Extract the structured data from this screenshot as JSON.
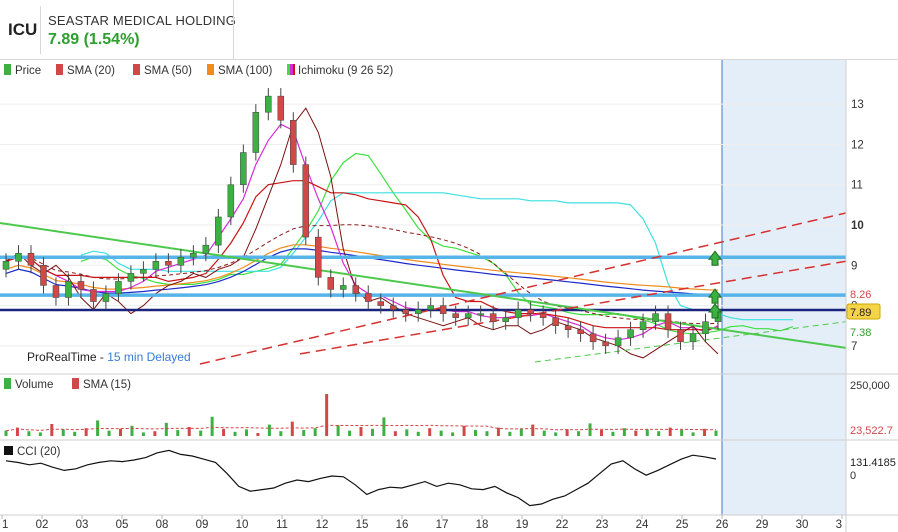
{
  "header": {
    "ticker": "ICU",
    "company": "SEASTAR MEDICAL HOLDING",
    "last": "7.89",
    "change": "(1.54%)"
  },
  "colors": {
    "up": "#3cb043",
    "down": "#d04848",
    "sma20": "#8b1a1a",
    "sma50": "#1c2bc8",
    "sma100": "#f08c1e",
    "tenkan": "#d62ad6",
    "kijun": "#c81414",
    "spanA": "#3ce03c",
    "spanB": "#3ce0e0",
    "future": "#e4eef8",
    "hline": "#56b4e9",
    "price_line": "#1a237e"
  },
  "legend": {
    "price": "Price",
    "sma20": "SMA (20)",
    "sma50": "SMA (50)",
    "sma100": "SMA (100)",
    "ichimoku": "Ichimoku (9 26 52)",
    "volume": "Volume",
    "vol_sma": "SMA (15)",
    "cci": "CCI (20)"
  },
  "watermark": {
    "brand": "ProRealTime",
    "dash": " - ",
    "delay": "15 min Delayed"
  },
  "chart_data": [
    {
      "type": "candlestick",
      "x_axis_labels": [
        "1",
        "02",
        "03",
        "05",
        "08",
        "09",
        "10",
        "11",
        "12",
        "15",
        "16",
        "17",
        "18",
        "19",
        "22",
        "23",
        "24",
        "25",
        "26",
        "29",
        "30",
        "3"
      ],
      "y_ticks": [
        "13",
        "12",
        "11",
        "10",
        "9",
        "8",
        "7"
      ],
      "ylim": [
        6.5,
        13.6
      ],
      "price_badge": "7.89",
      "labels": {
        "red": "8.26",
        "green": "7.38"
      },
      "horizontal_levels": [
        9.2,
        8.26,
        7.89
      ],
      "closes": [
        9.1,
        9.3,
        9.0,
        8.5,
        8.2,
        8.6,
        8.4,
        8.1,
        8.3,
        8.6,
        8.8,
        8.9,
        9.1,
        9.0,
        9.2,
        9.3,
        9.5,
        10.2,
        11.0,
        11.8,
        12.8,
        13.2,
        12.6,
        11.5,
        9.7,
        8.7,
        8.4,
        8.5,
        8.3,
        8.1,
        8.0,
        7.9,
        7.8,
        7.9,
        8.0,
        7.8,
        7.7,
        7.8,
        7.8,
        7.6,
        7.7,
        7.9,
        7.8,
        7.7,
        7.5,
        7.4,
        7.3,
        7.1,
        7.0,
        7.2,
        7.4,
        7.6,
        7.8,
        7.4,
        7.1,
        7.3,
        7.6,
        7.9
      ]
    },
    {
      "type": "bar",
      "title": "Volume",
      "y_ticks": [
        "250,000"
      ],
      "last_sma": "23,522.7",
      "values": [
        9,
        14,
        8,
        6,
        20,
        11,
        7,
        13,
        26,
        9,
        12,
        17,
        6,
        8,
        22,
        10,
        15,
        9,
        32,
        12,
        7,
        11,
        5,
        19,
        8,
        24,
        10,
        13,
        70,
        18,
        9,
        15,
        12,
        31,
        8,
        11,
        7,
        13,
        9,
        6,
        17,
        10,
        8,
        14,
        7,
        12,
        19,
        9,
        6,
        11,
        8,
        21,
        10,
        7,
        13,
        9,
        11,
        8,
        14,
        10,
        6,
        12,
        9
      ]
    },
    {
      "type": "line",
      "title": "CCI (20)",
      "y_ticks": [
        "0"
      ],
      "last_value": "131.4185",
      "values": [
        120,
        110,
        95,
        105,
        80,
        60,
        70,
        95,
        110,
        120,
        115,
        125,
        140,
        170,
        185,
        160,
        150,
        130,
        110,
        40,
        -40,
        -70,
        -60,
        -50,
        -20,
        0,
        -10,
        10,
        25,
        20,
        -30,
        -90,
        -60,
        -45,
        -50,
        -30,
        -10,
        -40,
        -20,
        -30,
        -55,
        -60,
        -40,
        -80,
        -110,
        -160,
        -150,
        -120,
        -100,
        -60,
        -20,
        40,
        100,
        120,
        70,
        30,
        60,
        95,
        130,
        155,
        145,
        131
      ]
    }
  ]
}
